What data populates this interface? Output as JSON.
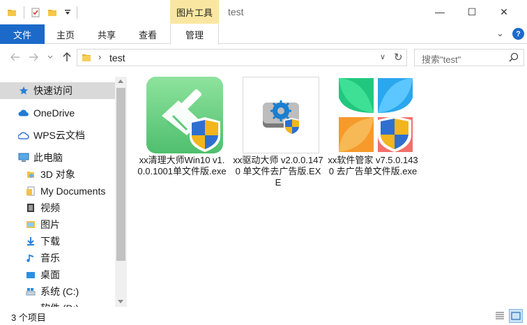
{
  "window": {
    "title": "test",
    "context_tab": "图片工具",
    "controls": {
      "minimize": "—",
      "maximize": "☐",
      "close": "✕"
    }
  },
  "ribbon": {
    "file_tab": "文件",
    "tabs": [
      "主页",
      "共享",
      "查看",
      "管理"
    ],
    "active_tab": "管理",
    "expand_glyph": "⌄",
    "help_glyph": "?"
  },
  "address": {
    "path": "test",
    "search_placeholder": "搜索\"test\""
  },
  "nav_pane": {
    "items": [
      {
        "label": "快速访问",
        "icon": "star-icon"
      },
      {
        "label": "OneDrive",
        "icon": "cloud-icon"
      },
      {
        "label": "WPS云文档",
        "icon": "wps-cloud-icon"
      },
      {
        "label": "此电脑",
        "icon": "computer-icon"
      },
      {
        "label": "3D 对象",
        "icon": "3d-objects-icon"
      },
      {
        "label": "My Documents",
        "icon": "documents-icon"
      },
      {
        "label": "视频",
        "icon": "video-icon"
      },
      {
        "label": "图片",
        "icon": "pictures-icon"
      },
      {
        "label": "下载",
        "icon": "download-icon"
      },
      {
        "label": "音乐",
        "icon": "music-icon"
      },
      {
        "label": "桌面",
        "icon": "desktop-icon"
      },
      {
        "label": "系统 (C:)",
        "icon": "drive-icon"
      },
      {
        "label": "软件 (D:)",
        "icon": "drive-icon"
      }
    ]
  },
  "files": [
    {
      "name": "xx清理大师Win10 v1.0.0.1001单文件版.exe",
      "icon": "broom-shield-app-icon"
    },
    {
      "name": "xx驱动大师 v2.0.0.1470 单文件去广告版.EXE",
      "icon": "gear-drive-shield-app-icon"
    },
    {
      "name": "xx软件管家 v7.5.0.1430 去广告单文件版.exe",
      "icon": "petal-shield-app-icon"
    }
  ],
  "status": {
    "item_count": "3 个项目"
  },
  "colors": {
    "accent": "#1b6ac9",
    "context_tab": "#f9e7a1",
    "selected_nav": "#d9d9d9"
  }
}
